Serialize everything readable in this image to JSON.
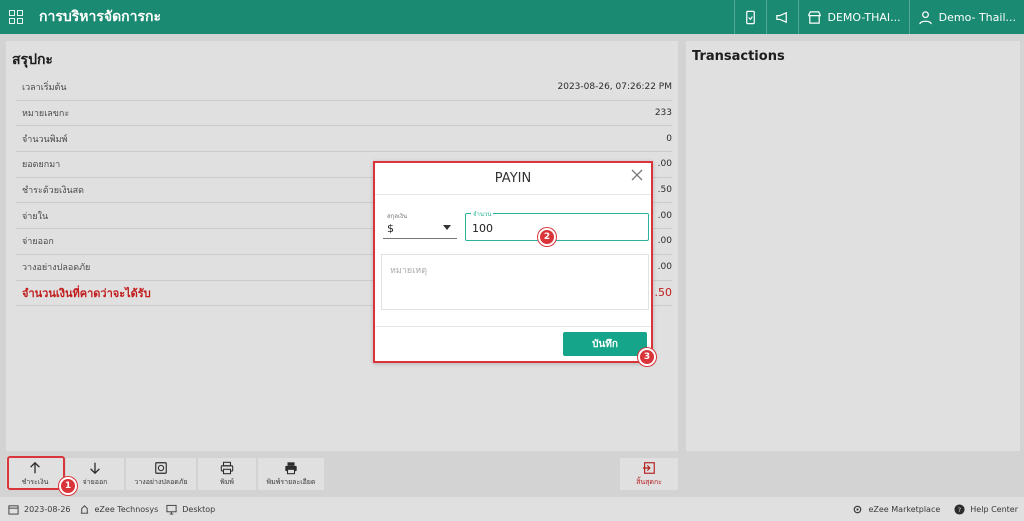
{
  "header": {
    "title": "การบริหารจัดการกะ",
    "location": "DEMO-THAI...",
    "user": "Demo- Thail..."
  },
  "summary": {
    "title": "สรุปกะ",
    "rows": [
      {
        "label": "เวลาเริ่มต้น",
        "value": "2023-08-26, 07:26:22 PM"
      },
      {
        "label": "หมายเลขกะ",
        "value": "233"
      },
      {
        "label": "จำนวนพิมพ์",
        "value": "0"
      },
      {
        "label": "ยอดยกมา",
        "value": ".00"
      },
      {
        "label": "ชำระด้วยเงินสด",
        "value": ".50"
      },
      {
        "label": "จ่ายใน",
        "value": ".00"
      },
      {
        "label": "จ่ายออก",
        "value": ".00"
      },
      {
        "label": "วางอย่างปลอดภัย",
        "value": ".00"
      }
    ],
    "total": {
      "label": "จำนวนเงินที่คาดว่าจะได้รับ",
      "value": ".50"
    }
  },
  "transactions": {
    "title": "Transactions"
  },
  "toolbar": {
    "payin": "ชำระเงิน",
    "payout": "จ่ายออก",
    "safe_drop": "วางอย่างปลอดภัย",
    "print": "พิมพ์",
    "print_detail": "พิมพ์รายละเอียด",
    "close_shift": "สิ้นสุดกะ"
  },
  "modal": {
    "title": "PAYIN",
    "currency_label": "สกุลเงิน",
    "currency_value": "$",
    "amount_label": "จำนวน",
    "amount_value": "100",
    "note_placeholder": "หมายเหตุ",
    "save": "บันทึก"
  },
  "statusbar": {
    "date": "2023-08-26",
    "company": "eZee Technosys",
    "device": "Desktop",
    "marketplace": "eZee Marketplace",
    "help": "Help Center"
  },
  "badges": [
    "1",
    "2",
    "3"
  ],
  "colors": {
    "brand": "#1a8a72",
    "accent": "#14a58a",
    "alert": "#d9343a"
  }
}
